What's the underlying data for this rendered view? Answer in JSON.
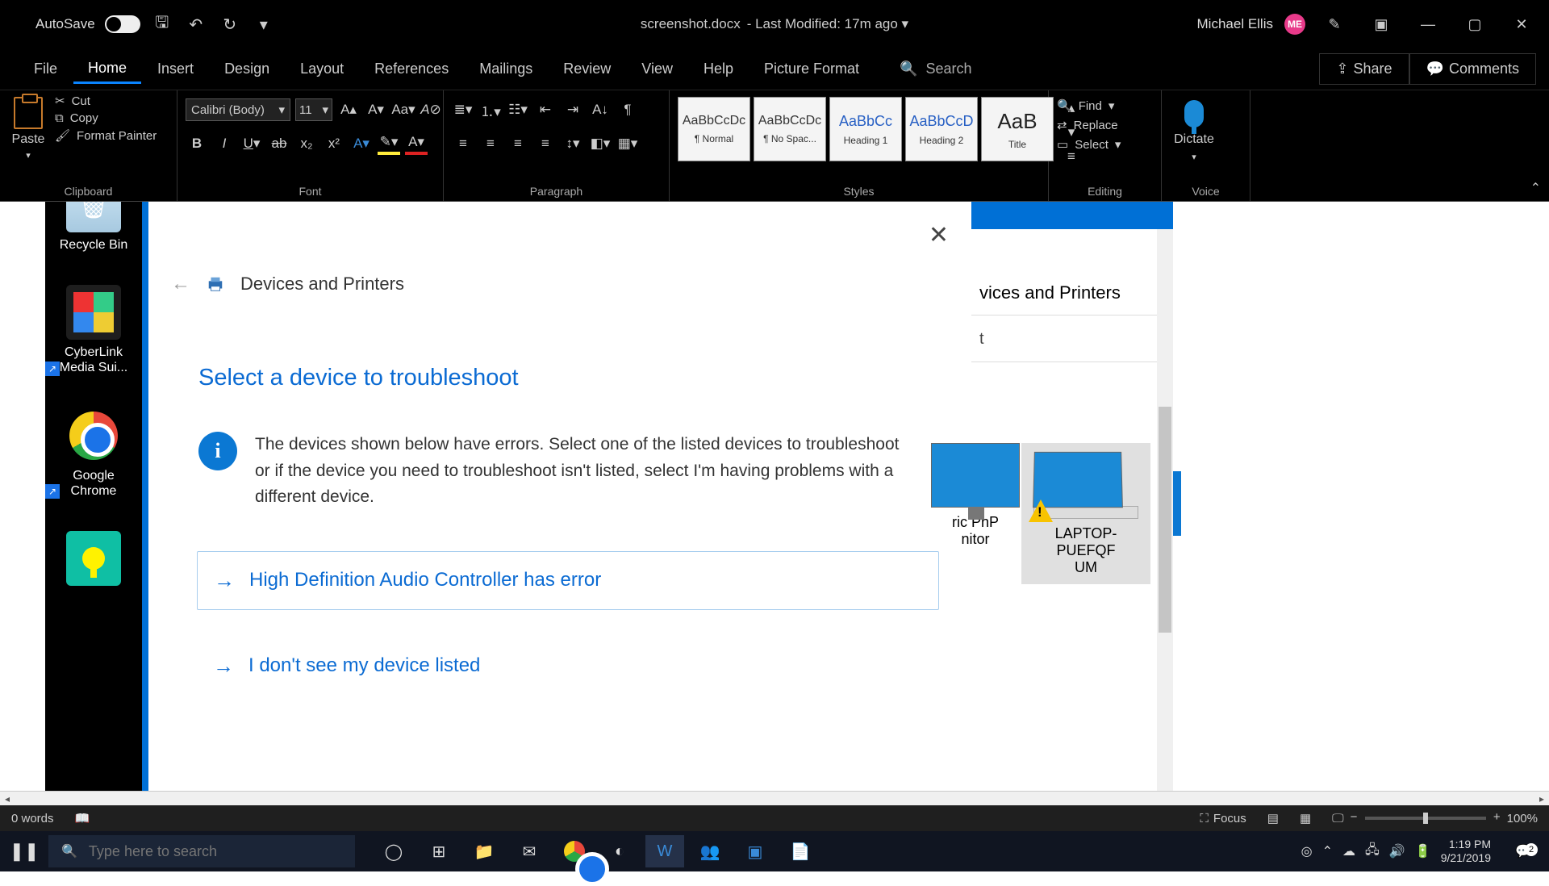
{
  "titlebar": {
    "autosave_label": "AutoSave",
    "doc_name": "screenshot.docx",
    "modified": "- Last Modified: 17m ago ▾",
    "user_name": "Michael Ellis",
    "user_initials": "ME"
  },
  "ribbon_tabs": {
    "items": [
      "File",
      "Home",
      "Insert",
      "Design",
      "Layout",
      "References",
      "Mailings",
      "Review",
      "View",
      "Help",
      "Picture Format"
    ],
    "active_index": 1,
    "search_placeholder": "Search",
    "share": "Share",
    "comments": "Comments"
  },
  "ribbon": {
    "clipboard": {
      "paste": "Paste",
      "cut": "Cut",
      "copy": "Copy",
      "fmt": "Format Painter",
      "label": "Clipboard"
    },
    "font": {
      "family": "Calibri (Body)",
      "size": "11",
      "label": "Font"
    },
    "paragraph": {
      "label": "Paragraph"
    },
    "styles": {
      "label": "Styles",
      "items": [
        {
          "preview": "AaBbCcDc",
          "name": "¶ Normal"
        },
        {
          "preview": "AaBbCcDc",
          "name": "¶ No Spac..."
        },
        {
          "preview": "AaBbCc",
          "name": "Heading 1"
        },
        {
          "preview": "AaBbCcD",
          "name": "Heading 2"
        },
        {
          "preview": "AaB",
          "name": "Title"
        }
      ]
    },
    "editing": {
      "find": "Find",
      "replace": "Replace",
      "select": "Select",
      "label": "Editing"
    },
    "voice": {
      "dictate": "Dictate",
      "label": "Voice"
    }
  },
  "desktop": {
    "recycle": "Recycle Bin",
    "cyberlink": "CyberLink Media Sui...",
    "chrome_l1": "Google",
    "chrome_l2": "Chrome"
  },
  "dialog": {
    "breadcrumb": "Devices and Printers",
    "heading": "Select a device to troubleshoot",
    "info": "The devices shown below have errors. Select one of the listed devices to troubleshoot or if the device you need to troubleshoot isn't listed, select I'm having problems with a different device.",
    "opt1": "High Definition Audio Controller has error",
    "opt2": "I don't see my device listed"
  },
  "dp": {
    "title_partial": "vices and Printers",
    "row2_partial": "t",
    "dev1_partial_l1": "ric PnP",
    "dev1_partial_l2": "nitor",
    "dev2_l1": "LAPTOP-PUEFQF",
    "dev2_l2": "UM"
  },
  "statusbar": {
    "words": "0 words",
    "focus": "Focus",
    "zoom": "100%"
  },
  "taskbar": {
    "search_placeholder": "Type here to search",
    "time": "1:19 PM",
    "date": "9/21/2019",
    "notif_count": "2"
  }
}
